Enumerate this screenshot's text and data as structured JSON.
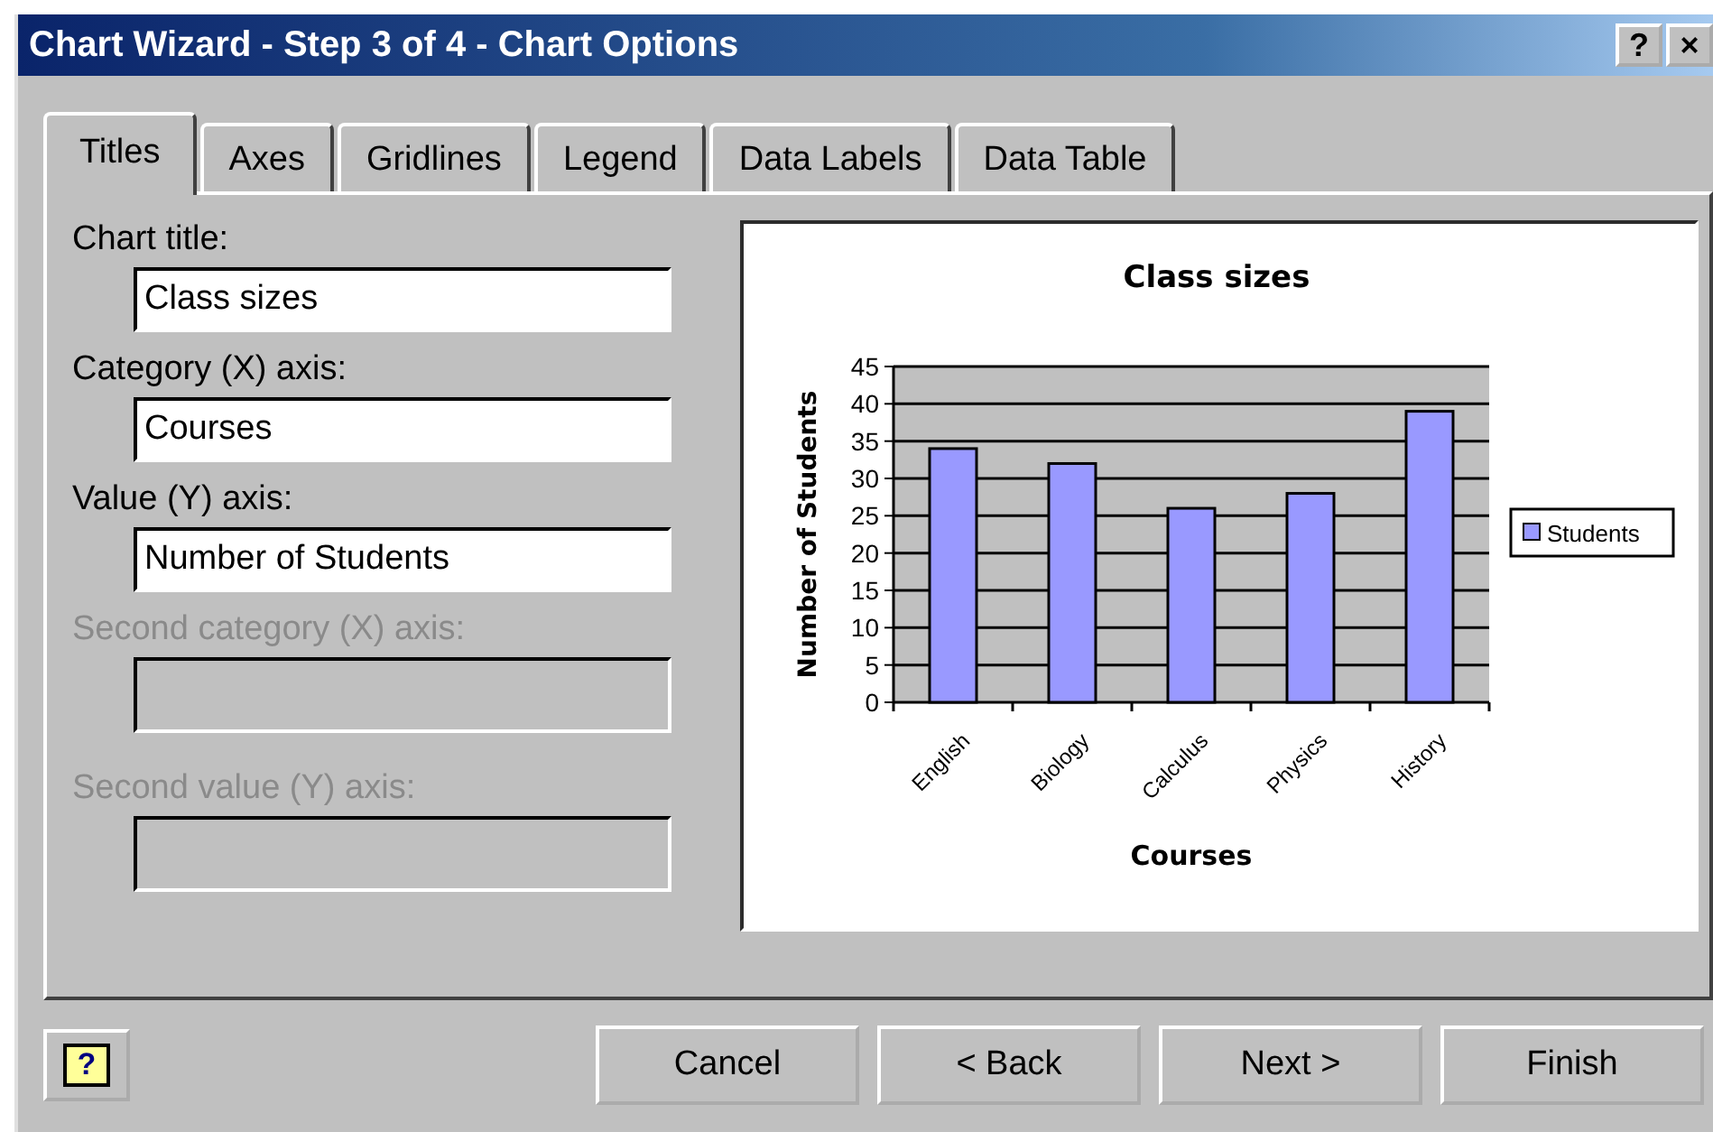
{
  "window": {
    "title": "Chart Wizard - Step 3 of 4 - Chart Options",
    "title_buttons": [
      "?",
      "×"
    ]
  },
  "tabs": [
    {
      "label": "Titles",
      "selected": true
    },
    {
      "label": "Axes",
      "selected": false
    },
    {
      "label": "Gridlines",
      "selected": false
    },
    {
      "label": "Legend",
      "selected": false
    },
    {
      "label": "Data Labels",
      "selected": false
    },
    {
      "label": "Data Table",
      "selected": false
    }
  ],
  "fields": [
    {
      "label": "Chart title:",
      "value": "Class sizes",
      "disabled": false
    },
    {
      "label": "Category (X) axis:",
      "value": "Courses",
      "disabled": false
    },
    {
      "label": "Value (Y) axis:",
      "value": "Number of Students",
      "disabled": false
    },
    {
      "label": "Second category (X) axis:",
      "disabled": true
    },
    {
      "label": "Second value (Y) axis:",
      "disabled": true
    }
  ],
  "preview": {
    "chart_data": {
      "type": "bar",
      "title": "Class sizes",
      "xlabel": "Courses",
      "ylabel": "Number of Students",
      "categories": [
        "English",
        "Biology",
        "Calculus",
        "Physics",
        "History"
      ],
      "series": [
        {
          "name": "Students",
          "color": "#9999ff",
          "values": [
            34,
            32,
            26,
            28,
            39
          ]
        }
      ],
      "ylim": [
        0,
        45
      ],
      "grid": true,
      "yticks": [
        0,
        5,
        10,
        15,
        20,
        25,
        30,
        35,
        40,
        45
      ]
    }
  },
  "help_button": {
    "glyph": "?"
  },
  "buttons": [
    "Cancel",
    "< Back",
    "Next >",
    "Finish"
  ]
}
